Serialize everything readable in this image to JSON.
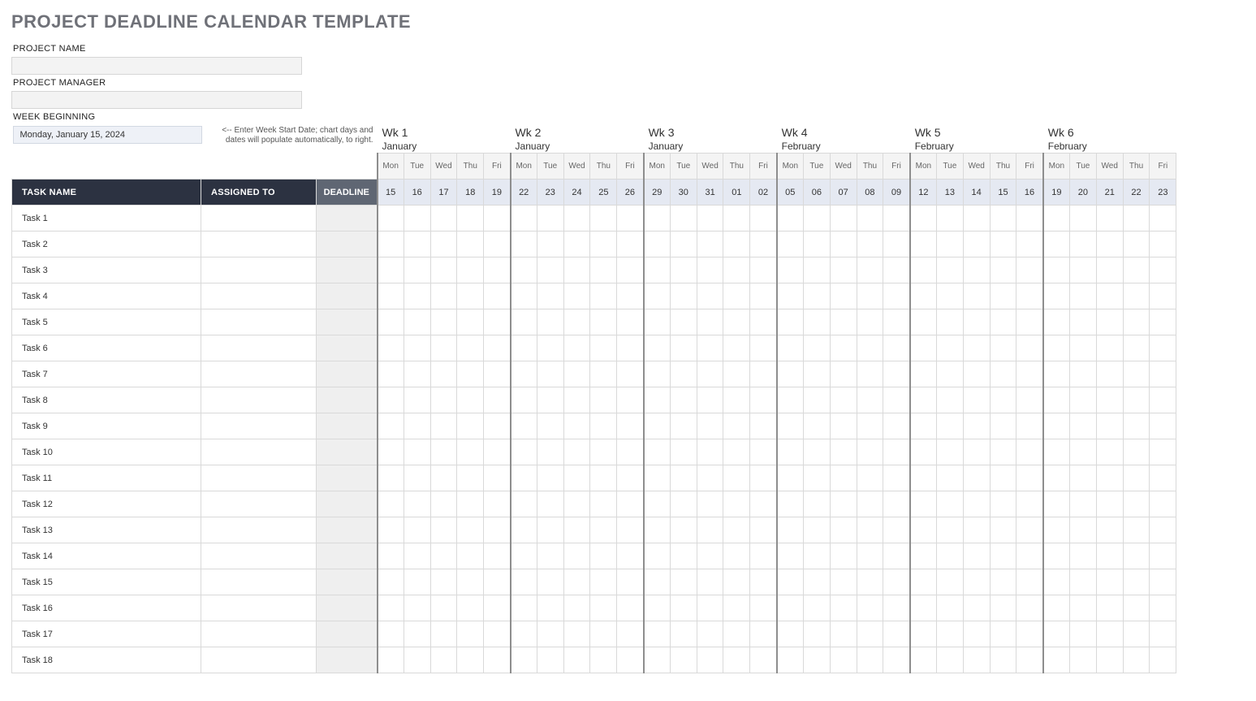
{
  "title": "PROJECT DEADLINE CALENDAR TEMPLATE",
  "fields": {
    "project_name_label": "PROJECT NAME",
    "project_name_value": "",
    "project_manager_label": "PROJECT MANAGER",
    "project_manager_value": "",
    "week_beginning_label": "WEEK BEGINNING",
    "week_beginning_value": "Monday, January 15, 2024",
    "week_beginning_hint": "<-- Enter Week Start Date; chart days and dates will populate automatically, to right."
  },
  "headers": {
    "task_name": "TASK NAME",
    "assigned_to": "ASSIGNED TO",
    "deadline": "DEADLINE"
  },
  "weeks": [
    {
      "label": "Wk 1",
      "month": "January",
      "days": [
        "Mon",
        "Tue",
        "Wed",
        "Thu",
        "Fri"
      ],
      "dates": [
        "15",
        "16",
        "17",
        "18",
        "19"
      ]
    },
    {
      "label": "Wk 2",
      "month": "January",
      "days": [
        "Mon",
        "Tue",
        "Wed",
        "Thu",
        "Fri"
      ],
      "dates": [
        "22",
        "23",
        "24",
        "25",
        "26"
      ]
    },
    {
      "label": "Wk 3",
      "month": "January",
      "days": [
        "Mon",
        "Tue",
        "Wed",
        "Thu",
        "Fri"
      ],
      "dates": [
        "29",
        "30",
        "31",
        "01",
        "02"
      ]
    },
    {
      "label": "Wk 4",
      "month": "February",
      "days": [
        "Mon",
        "Tue",
        "Wed",
        "Thu",
        "Fri"
      ],
      "dates": [
        "05",
        "06",
        "07",
        "08",
        "09"
      ]
    },
    {
      "label": "Wk 5",
      "month": "February",
      "days": [
        "Mon",
        "Tue",
        "Wed",
        "Thu",
        "Fri"
      ],
      "dates": [
        "12",
        "13",
        "14",
        "15",
        "16"
      ]
    },
    {
      "label": "Wk 6",
      "month": "February",
      "days": [
        "Mon",
        "Tue",
        "Wed",
        "Thu",
        "Fri"
      ],
      "dates": [
        "19",
        "20",
        "21",
        "22",
        "23"
      ]
    }
  ],
  "tasks": [
    {
      "name": "Task 1",
      "assigned": "",
      "deadline": ""
    },
    {
      "name": "Task 2",
      "assigned": "",
      "deadline": ""
    },
    {
      "name": "Task 3",
      "assigned": "",
      "deadline": ""
    },
    {
      "name": "Task 4",
      "assigned": "",
      "deadline": ""
    },
    {
      "name": "Task 5",
      "assigned": "",
      "deadline": ""
    },
    {
      "name": "Task 6",
      "assigned": "",
      "deadline": ""
    },
    {
      "name": "Task 7",
      "assigned": "",
      "deadline": ""
    },
    {
      "name": "Task 8",
      "assigned": "",
      "deadline": ""
    },
    {
      "name": "Task 9",
      "assigned": "",
      "deadline": ""
    },
    {
      "name": "Task 10",
      "assigned": "",
      "deadline": ""
    },
    {
      "name": "Task 11",
      "assigned": "",
      "deadline": ""
    },
    {
      "name": "Task 12",
      "assigned": "",
      "deadline": ""
    },
    {
      "name": "Task 13",
      "assigned": "",
      "deadline": ""
    },
    {
      "name": "Task 14",
      "assigned": "",
      "deadline": ""
    },
    {
      "name": "Task 15",
      "assigned": "",
      "deadline": ""
    },
    {
      "name": "Task 16",
      "assigned": "",
      "deadline": ""
    },
    {
      "name": "Task 17",
      "assigned": "",
      "deadline": ""
    },
    {
      "name": "Task 18",
      "assigned": "",
      "deadline": ""
    }
  ]
}
